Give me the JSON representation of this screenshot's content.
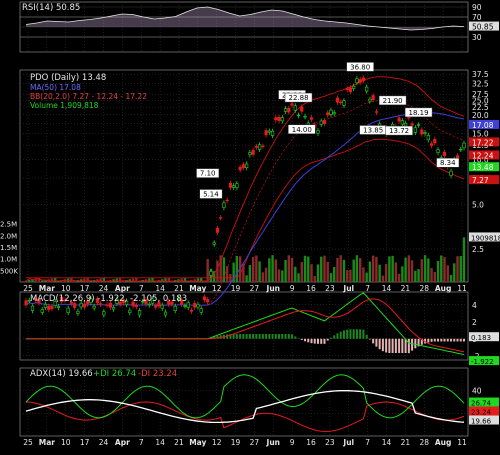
{
  "colors": {
    "bg": "#000000",
    "grid": "#3a3a3a",
    "text": "#e6e6e6",
    "up": "#1fd81f",
    "down": "#e61c1c",
    "ma50": "#3f3fd9",
    "bb": "#cc1111",
    "volume_up": "#1a8a1a",
    "volume_down": "#8a2a2a",
    "rsi": "#c8a8d8",
    "adx": "#ffffff",
    "pdi": "#1fd81f",
    "mdi": "#e61c1c",
    "macd_line": "#1fd81f",
    "macd_signal": "#e61c1c",
    "macd_hist": "#e6b3b3"
  },
  "chart_data": [
    {
      "type": "line",
      "name": "rsi",
      "legend": "RSI(14) 50.85",
      "value_label": "50.85",
      "ylim": [
        0,
        100
      ],
      "ticks": [
        90,
        70,
        50,
        30
      ],
      "values": [
        55,
        58,
        62,
        61,
        60,
        63,
        65,
        68,
        72,
        76,
        75,
        70,
        66,
        68,
        71,
        80,
        88,
        90,
        85,
        78,
        72,
        75,
        80,
        84,
        82,
        76,
        70,
        65,
        62,
        60,
        58,
        55,
        52,
        50,
        48,
        46,
        44,
        45,
        47,
        50,
        52,
        50.85
      ]
    },
    {
      "type": "candlestick",
      "name": "price",
      "legend": {
        "title": "PDO (Daily) 13.48",
        "ma": "MA(50) 17.08",
        "bb": "BB(20,2.0) 7.27 - 12.24 - 17.22",
        "volume": "Volume 1,909,818"
      },
      "ylim": [
        1.5,
        40
      ],
      "log": true,
      "y_ticks": [
        37.5,
        32.5,
        27.5,
        25.0,
        22.5,
        20.0,
        17.5,
        15.0,
        12.5,
        10.0,
        7.5,
        5.0,
        2.5
      ],
      "annotations": [
        {
          "label": "36.80",
          "index": 103
        },
        {
          "label": "23.90",
          "index": 82
        },
        {
          "label": "22.88",
          "index": 84
        },
        {
          "label": "21.90",
          "index": 113
        },
        {
          "label": "18.19",
          "index": 121
        },
        {
          "label": "14.00",
          "index": 85
        },
        {
          "label": "13.85",
          "index": 107
        },
        {
          "label": "13.72",
          "index": 115
        },
        {
          "label": "7.10",
          "index": 56
        },
        {
          "label": "5.14",
          "index": 57
        },
        {
          "label": "8.34",
          "index": 130
        }
      ],
      "right_labels": [
        {
          "label": "17.08",
          "value": 17.08,
          "color": "#3f3fd9"
        },
        {
          "label": "17.22",
          "value": 17.22,
          "color": "#cc1111"
        },
        {
          "label": "12.24",
          "value": 12.24,
          "color": "#cc1111"
        },
        {
          "label": "13.48",
          "value": 13.48,
          "color": "#1fd81f"
        },
        {
          "label": "7.27",
          "value": 7.27,
          "color": "#cc1111"
        }
      ],
      "volume_ylim": [
        0,
        3000000
      ],
      "volume_ticks": [
        "2.5M",
        "2.0M",
        "1.5M",
        "1.0M",
        "500K"
      ],
      "volume_right_label": "1909818"
    },
    {
      "type": "bar",
      "name": "macd",
      "legend": "MACD(12,26,9) -1.922, -2.105, 0.183",
      "ylim": [
        -2.5,
        5.5
      ],
      "ticks": [
        4,
        2,
        0,
        -2
      ],
      "right_labels": [
        "0.183",
        "-1.922"
      ]
    },
    {
      "type": "line",
      "name": "adx",
      "legend": {
        "adx": "ADX(14) 19.66",
        "pdi": "+DI 26.74",
        "mdi": "-DI 23.24"
      },
      "ylim": [
        0,
        60
      ],
      "ticks": [
        40,
        20
      ],
      "right_labels": [
        "26.74",
        "23.24",
        "19.66"
      ]
    }
  ],
  "x_axis": {
    "labels": [
      "25",
      "Mar",
      "10",
      "17",
      "24",
      "Apr",
      "7",
      "14",
      "21",
      "May",
      "12",
      "19",
      "27",
      "Jun",
      "9",
      "16",
      "23",
      "Jul",
      "7",
      "14",
      "21",
      "28",
      "Aug",
      "11"
    ],
    "bold": [
      "Mar",
      "Apr",
      "May",
      "Jun",
      "Jul",
      "Aug"
    ]
  }
}
